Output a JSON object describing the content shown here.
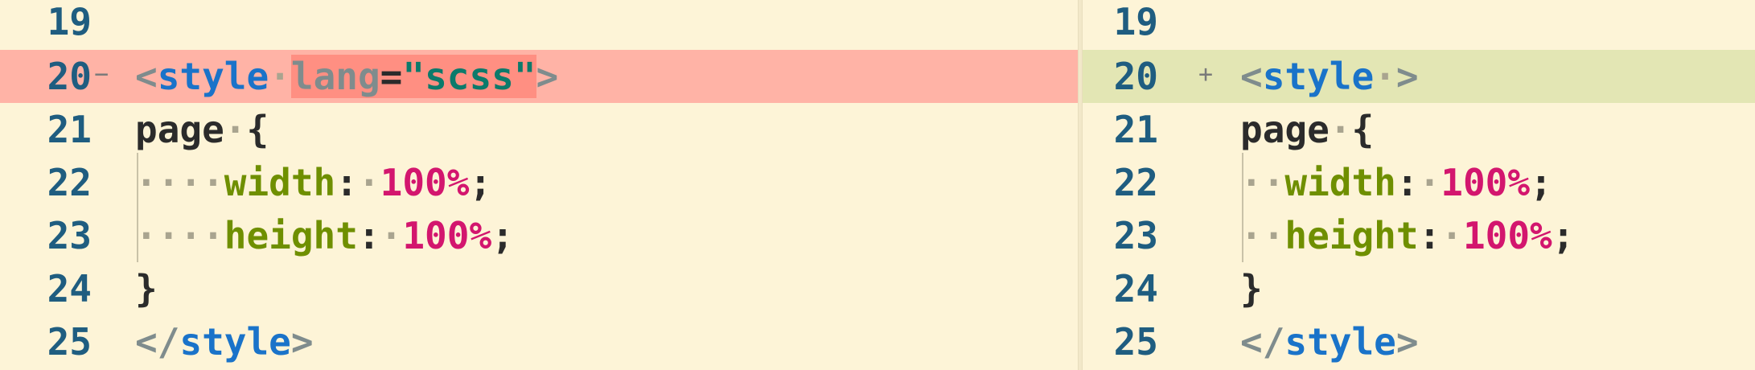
{
  "left": {
    "lines": [
      {
        "num": "19",
        "marker": ""
      },
      {
        "num": "20",
        "marker": "−"
      },
      {
        "num": "21",
        "marker": ""
      },
      {
        "num": "22",
        "marker": ""
      },
      {
        "num": "23",
        "marker": ""
      },
      {
        "num": "24",
        "marker": ""
      },
      {
        "num": "25",
        "marker": ""
      }
    ],
    "line20": {
      "open": "<",
      "tag": "style",
      "ws": "·",
      "attr": "lang",
      "eq": "=",
      "val": "\"scss\"",
      "close": ">"
    },
    "line21": {
      "sel": "page",
      "ws": "·",
      "brace": "{"
    },
    "line22": {
      "indent": "····",
      "prop": "width",
      "colon": ":",
      "ws": "·",
      "val": "100%",
      "semi": ";"
    },
    "line23": {
      "indent": "····",
      "prop": "height",
      "colon": ":",
      "ws": "·",
      "val": "100%",
      "semi": ";"
    },
    "line24": {
      "brace": "}"
    },
    "line25": {
      "open": "</",
      "tag": "style",
      "close": ">"
    }
  },
  "right": {
    "lines": [
      {
        "num": "19",
        "marker": ""
      },
      {
        "num": "20",
        "marker": "+"
      },
      {
        "num": "21",
        "marker": ""
      },
      {
        "num": "22",
        "marker": ""
      },
      {
        "num": "23",
        "marker": ""
      },
      {
        "num": "24",
        "marker": ""
      },
      {
        "num": "25",
        "marker": ""
      }
    ],
    "line20": {
      "open": "<",
      "tag": "style",
      "ws": "·",
      "close": ">"
    },
    "line21": {
      "sel": "page",
      "ws": "·",
      "brace": "{"
    },
    "line22": {
      "indent": "··",
      "prop": "width",
      "colon": ":",
      "ws": "·",
      "val": "100%",
      "semi": ";"
    },
    "line23": {
      "indent": "··",
      "prop": "height",
      "colon": ":",
      "ws": "·",
      "val": "100%",
      "semi": ";"
    },
    "line24": {
      "brace": "}"
    },
    "line25": {
      "open": "</",
      "tag": "style",
      "close": ">"
    }
  },
  "colors": {
    "background": "#fdf4d7",
    "removed_line": "#ffb3a6",
    "removed_highlight": "#ff8f82",
    "added_line": "#e3e6b4",
    "line_number": "#1f5d80",
    "tag_name": "#1a73c9",
    "attr_value": "#0c7a6b",
    "property": "#6f8f00",
    "number": "#d3166e"
  }
}
